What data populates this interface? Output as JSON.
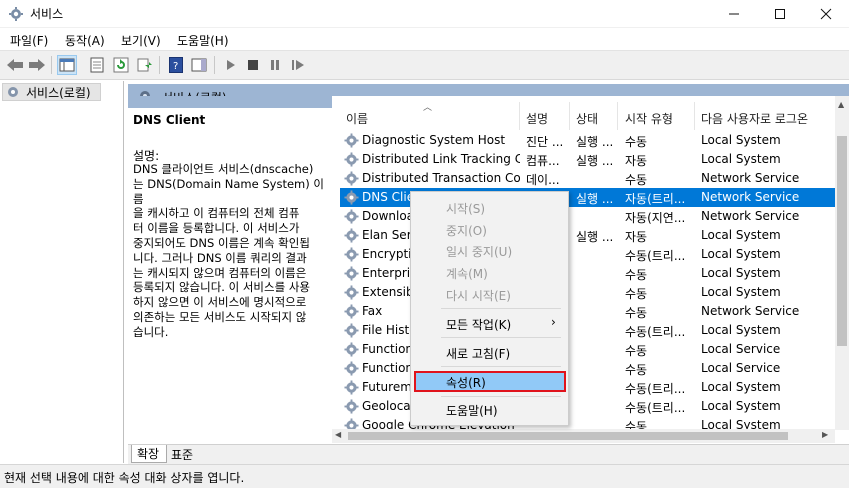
{
  "window": {
    "title": "서비스"
  },
  "menu": [
    "파일(F)",
    "동작(A)",
    "보기(V)",
    "도움말(H)"
  ],
  "tree": {
    "root": "서비스(로컬)"
  },
  "panel": {
    "header": "서비스(로컬)",
    "service_name": "DNS Client",
    "desc_label": "설명:",
    "desc_lines": [
      "DNS 클라이언트 서비스(dnscache)",
      "는 DNS(Domain Name System) 이름",
      "을 캐시하고 이 컴퓨터의 전체 컴퓨",
      "터 이름을 등록합니다. 이 서비스가",
      "중지되어도 DNS 이름은 계속 확인됩",
      "니다. 그러나 DNS 이름 쿼리의 결과",
      "는 캐시되지 않으며 컴퓨터의 이름은",
      "등록되지 않습니다. 이 서비스를 사용",
      "하지 않으면 이 서비스에 명시적으로",
      "의존하는 모든 서비스도 시작되지 않",
      "습니다."
    ]
  },
  "columns": {
    "name": "이름",
    "desc": "설명",
    "status": "상태",
    "startup": "시작 유형",
    "logon": "다음 사용자로 로그온"
  },
  "rows": [
    {
      "name": "Diagnostic System Host",
      "desc": "진단 ...",
      "status": "실행 ...",
      "startup": "수동",
      "logon": "Local System"
    },
    {
      "name": "Distributed Link Tracking C...",
      "desc": "컴퓨...",
      "status": "실행 ...",
      "startup": "자동",
      "logon": "Local System"
    },
    {
      "name": "Distributed Transaction Co...",
      "desc": "데이...",
      "status": "",
      "startup": "수동",
      "logon": "Network Service"
    },
    {
      "name": "DNS Client",
      "desc": "",
      "status": "실행 ...",
      "startup": "자동(트리...",
      "logon": "Network Service"
    },
    {
      "name": "Download",
      "desc": "",
      "status": "",
      "startup": "자동(지연...",
      "logon": "Network Service"
    },
    {
      "name": "Elan Service",
      "desc": "",
      "status": "실행 ...",
      "startup": "자동",
      "logon": "Local System"
    },
    {
      "name": "Encrypting",
      "desc": "",
      "status": "",
      "startup": "수동(트리...",
      "logon": "Local System"
    },
    {
      "name": "Enterprise",
      "desc": "",
      "status": "",
      "startup": "수동",
      "logon": "Local System"
    },
    {
      "name": "Extensible",
      "desc": "",
      "status": "",
      "startup": "수동",
      "logon": "Local System"
    },
    {
      "name": "Fax",
      "desc": "",
      "status": "",
      "startup": "수동",
      "logon": "Network Service"
    },
    {
      "name": "File History",
      "desc": "",
      "status": "",
      "startup": "수동(트리...",
      "logon": "Local System"
    },
    {
      "name": "Function",
      "desc": "",
      "status": "",
      "startup": "수동",
      "logon": "Local Service"
    },
    {
      "name": "Function",
      "desc": "",
      "status": "",
      "startup": "수동",
      "logon": "Local Service"
    },
    {
      "name": "Futuremark",
      "desc": "",
      "status": "",
      "startup": "수동(트리...",
      "logon": "Local System"
    },
    {
      "name": "Geolocation",
      "desc": "",
      "status": "",
      "startup": "수동(트리...",
      "logon": "Local System"
    },
    {
      "name": "Google Chrome Elevation",
      "desc": "",
      "status": "",
      "startup": "수동",
      "logon": "Local System"
    }
  ],
  "context_menu": {
    "start": "시작(S)",
    "stop": "중지(O)",
    "pause": "일시 중지(U)",
    "resume": "계속(M)",
    "restart": "다시 시작(E)",
    "all_tasks": "모든 작업(K)",
    "refresh": "새로 고침(F)",
    "properties": "속성(R)",
    "help": "도움말(H)"
  },
  "tabs": [
    "확장",
    "표준"
  ],
  "status": "현재 선택 내용에 대한 속성 대화 상자를 엽니다.",
  "colors": {
    "selection": "#0078d7",
    "header": "#9db5d3",
    "highlight_border": "#e0131c"
  }
}
